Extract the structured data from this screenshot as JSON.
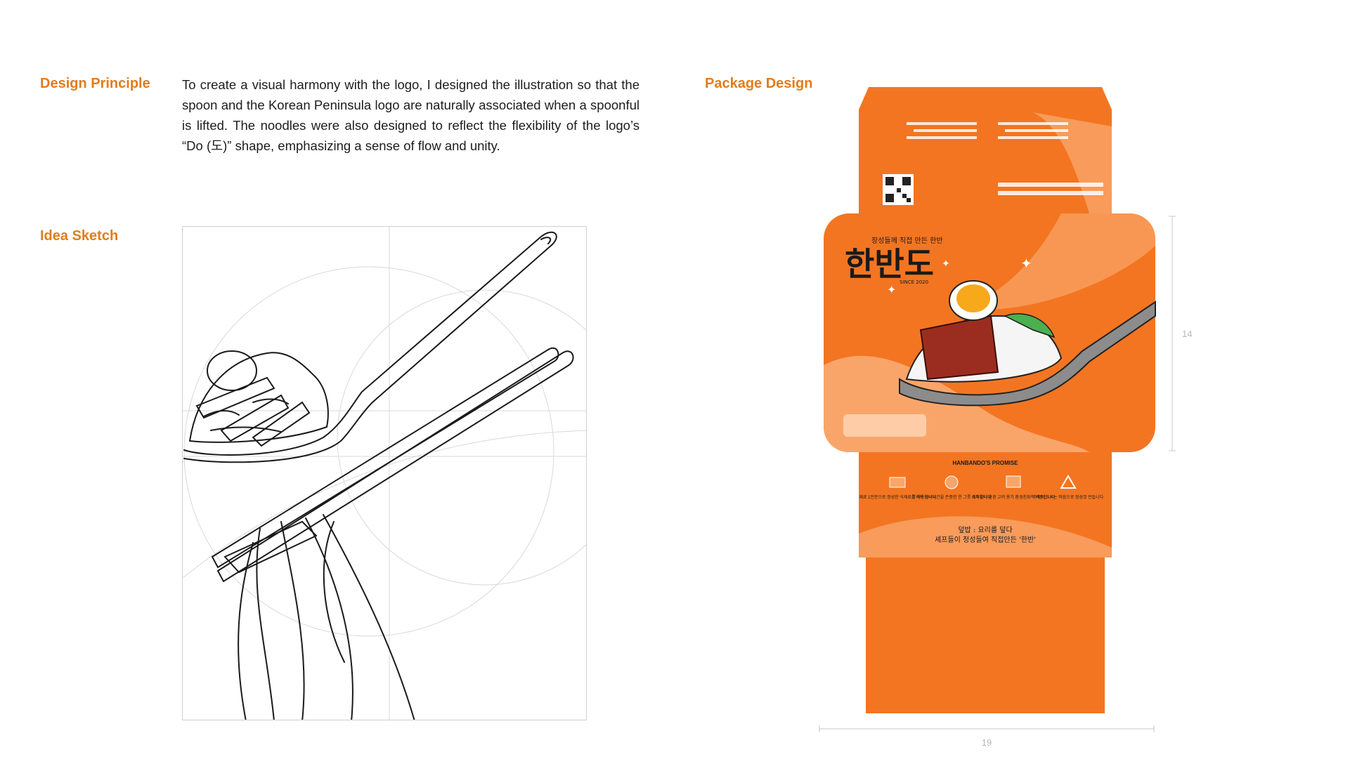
{
  "design_principle": {
    "heading": "Design Principle",
    "text": "To create a visual harmony with the logo, I designed the illustration so that the spoon and the Korean Peninsula logo are naturally associated when a spoonful is lifted. The noodles were also designed to reflect the flexibility of the logo’s “Do (도)” shape, emphasizing a sense of flow and unity."
  },
  "idea_sketch": {
    "heading": "Idea Sketch"
  },
  "package_design": {
    "heading": "Package Design",
    "logo_tagline": "장성들께 직접 만든 한반",
    "logo_text": "한반도",
    "logo_since": "SINCE 2020",
    "promise_title": "HANBANDO'S PROMISE",
    "promise_items": [
      "재료 1인분으로 정성한\n식재료를 사용합니다",
      "고객의 식사시간을 존중한\n한 그릇 제작합니다",
      "소재부터 환경 고려 용기\n환경친화적 제품합니다",
      "가족이 드시는 마음으로\n정성껏 만듭니다"
    ],
    "slogan_line1": "덮밥 : 요리를 덮다",
    "slogan_line2": "셰프들이 정성들여 직접만든 '한반'",
    "dim_height": "14",
    "dim_width": "19"
  },
  "colors": {
    "accent": "#e07d1c",
    "package_orange": "#f37521",
    "package_dark": "#e86a12",
    "package_light": "#f9a56a"
  }
}
